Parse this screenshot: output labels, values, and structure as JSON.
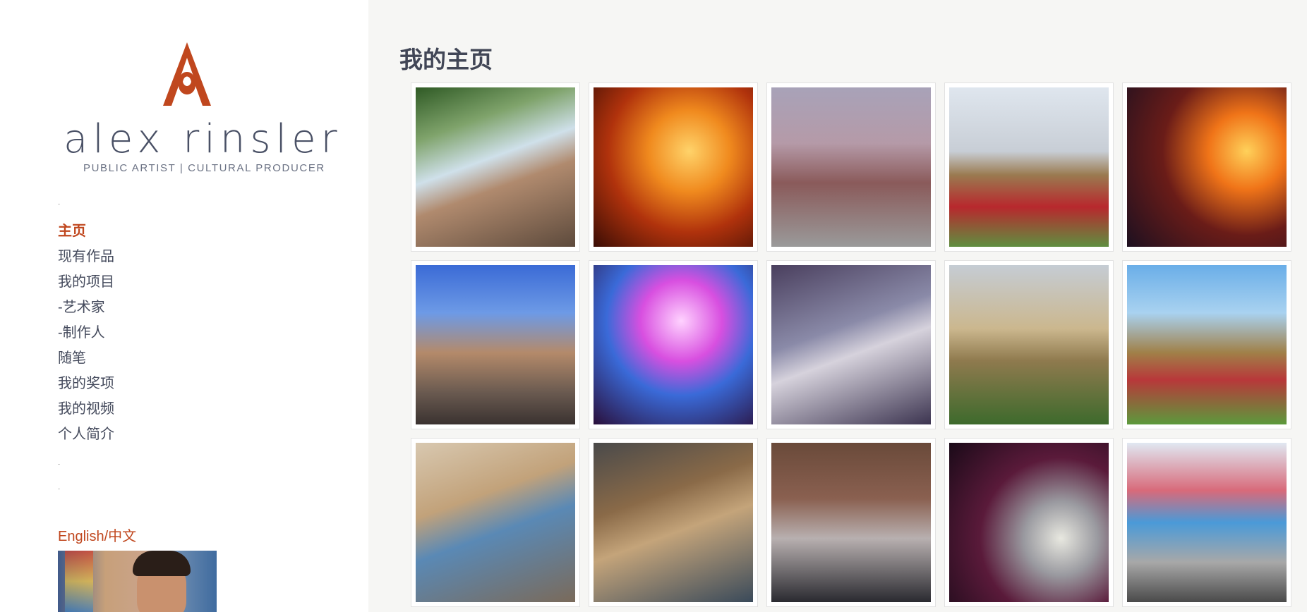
{
  "brand": {
    "name_bold": "alex",
    "name_light": "rinsler",
    "tagline": "PUBLIC ARTIST | CULTURAL PRODUCER",
    "accent_color": "#c0471e"
  },
  "nav": {
    "items": [
      {
        "label": "主页",
        "active": true
      },
      {
        "label": "现有作品"
      },
      {
        "label": "我的项目"
      },
      {
        "label": "-艺术家"
      },
      {
        "label": "-制作人"
      },
      {
        "label": "随笔"
      },
      {
        "label": "我的奖项"
      },
      {
        "label": "我的视频"
      },
      {
        "label": "个人简介"
      }
    ]
  },
  "language_switch": "English/中文",
  "main": {
    "title": "我的主页"
  },
  "gallery": {
    "thumbnails": [
      {
        "icon": "sculpture-tree-photo",
        "bg": "linear-gradient(160deg,#2f5a25 0%,#7fa36b 25%,#cfe0ea 45%,#b08a6e 60%,#5d4a3c 100%)"
      },
      {
        "icon": "burning-ship-photo",
        "bg": "radial-gradient(circle at 60% 40%,#ffd36a 0%,#f08a1e 30%,#b0320c 60%,#3a0d05 100%)"
      },
      {
        "icon": "crowd-performers-photo",
        "bg": "linear-gradient(180deg,#a8a2b8 0%,#b59aa8 35%,#8a5a5a 60%,#9a9a9a 100%)"
      },
      {
        "icon": "giant-fox-sculpture-photo",
        "bg": "linear-gradient(180deg,#dfe6ee 0%,#c8ced6 40%,#9a7a50 55%,#b8282d 75%,#5f8f40 100%)"
      },
      {
        "icon": "fire-night-photo",
        "bg": "radial-gradient(circle at 75% 40%,#ffd15a 0%,#f07418 25%,#6a1c18 55%,#1d1020 100%)"
      },
      {
        "icon": "giraffe-sculpture-photo",
        "bg": "linear-gradient(180deg,#3b6bd6 0%,#6d9ae6 30%,#b48a6a 55%,#6a5a50 80%,#3a3230 100%)"
      },
      {
        "icon": "illuminated-building-photo",
        "bg": "radial-gradient(circle at 55% 35%,#ffd2ff 0%,#d84fe0 30%,#3a6ad8 55%,#2a0f3a 100%)"
      },
      {
        "icon": "crowd-aerial-photo",
        "bg": "linear-gradient(160deg,#4a3f5e 0%,#8a8aa8 40%,#d6d2dc 55%,#3c3450 100%)"
      },
      {
        "icon": "fox-sculpture-park-photo",
        "bg": "linear-gradient(180deg,#c5ccd4 0%,#cbb78e 40%,#8f7a4e 60%,#3d6a2c 100%)"
      },
      {
        "icon": "fox-sculpture-container-photo",
        "bg": "linear-gradient(180deg,#6aaee8 0%,#a9d2f0 30%,#a08048 55%,#b8383a 72%,#5c9a3c 100%)"
      },
      {
        "icon": "city-street-letters-photo",
        "bg": "linear-gradient(160deg,#d8c8b0 0%,#c2a27a 35%,#5a89b5 55%,#7a6a5a 100%)"
      },
      {
        "icon": "cardboard-sculpture-photo",
        "bg": "linear-gradient(160deg,#4a4a4a 0%,#8a6a48 35%,#c4a47a 55%,#3a4a5a 100%)"
      },
      {
        "icon": "chess-players-photo",
        "bg": "linear-gradient(180deg,#6a4a3a 0%,#8a6050 35%,#b8b0b0 60%,#2a2a30 100%)"
      },
      {
        "icon": "blackpool-illuminations-photo",
        "bg": "radial-gradient(circle at 70% 60%,#e8e8e0 0%,#9a9aa0 25%,#5a1a3a 55%,#1a0a18 100%)"
      },
      {
        "icon": "colorful-tower-sculpture-photo",
        "bg": "linear-gradient(180deg,#e0e8f2 0%,#d86a7a 30%,#4a9ad8 50%,#a8a8a8 75%,#4a4a4a 100%)"
      }
    ]
  }
}
